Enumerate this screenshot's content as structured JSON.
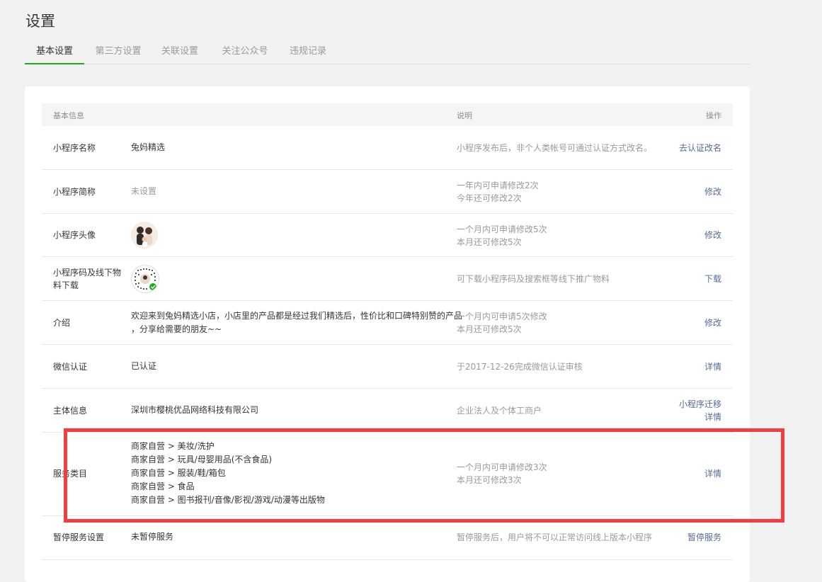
{
  "page": {
    "title": "设置"
  },
  "tabs": [
    {
      "label": "基本设置"
    },
    {
      "label": "第三方设置"
    },
    {
      "label": "关联设置"
    },
    {
      "label": "关注公众号"
    },
    {
      "label": "违规记录"
    }
  ],
  "table": {
    "headers": {
      "info": "基本信息",
      "desc": "说明",
      "action": "操作"
    },
    "rows": [
      {
        "label": "小程序名称",
        "value": "兔妈精选",
        "desc": [
          "小程序发布后，非个人类帐号可通过认证方式改名。"
        ],
        "actions": [
          "去认证改名"
        ]
      },
      {
        "label": "小程序简称",
        "value": "未设置",
        "desc": [
          "一年内可申请修改2次",
          "今年还可修改2次"
        ],
        "actions": [
          "修改"
        ]
      },
      {
        "label": "小程序头像",
        "value": "",
        "desc": [
          "一个月内可申请修改5次",
          "本月还可修改5次"
        ],
        "actions": [
          "修改"
        ]
      },
      {
        "label": "小程序码及线下物料下载",
        "value": "",
        "desc": [
          "可下载小程序码及搜索框等线下推广物料"
        ],
        "actions": [
          "下载"
        ]
      },
      {
        "label": "介绍",
        "value": "欢迎来到兔妈精选小店，小店里的产品都是经过我们精选后，性价比和口碑特别赞的产品",
        "value2": "，分享给需要的朋友~~",
        "desc": [
          "一个月内可申请5次修改",
          "本月还可修改5次"
        ],
        "actions": [
          "修改"
        ]
      },
      {
        "label": "微信认证",
        "value": "已认证",
        "desc": [
          "于2017-12-26完成微信认证审核"
        ],
        "actions": [
          "详情"
        ]
      },
      {
        "label": "主体信息",
        "value": "深圳市樱桃优品网络科技有限公司",
        "desc": [
          "企业法人及个体工商户"
        ],
        "actions": [
          "小程序迁移",
          "详情"
        ]
      },
      {
        "label": "服务类目",
        "categories": [
          "商家自营 > 美妆/洗护",
          "商家自营 > 玩具/母婴用品(不含食品)",
          "商家自营 > 服装/鞋/箱包",
          "商家自营 > 食品",
          "商家自营 > 图书报刊/音像/影视/游戏/动漫等出版物"
        ],
        "desc": [
          "一个月内可申请修改3次",
          "本月还可修改3次"
        ],
        "actions": [
          "详情"
        ]
      },
      {
        "label": "暂停服务设置",
        "value": "未暂停服务",
        "desc": [
          "暂停服务后，用户将不可以正常访问线上版本小程序"
        ],
        "actions": [
          "暂停服务"
        ]
      }
    ]
  },
  "colors": {
    "accent": "#1aad19",
    "link": "#576b95",
    "highlight": "#f23e3e"
  }
}
